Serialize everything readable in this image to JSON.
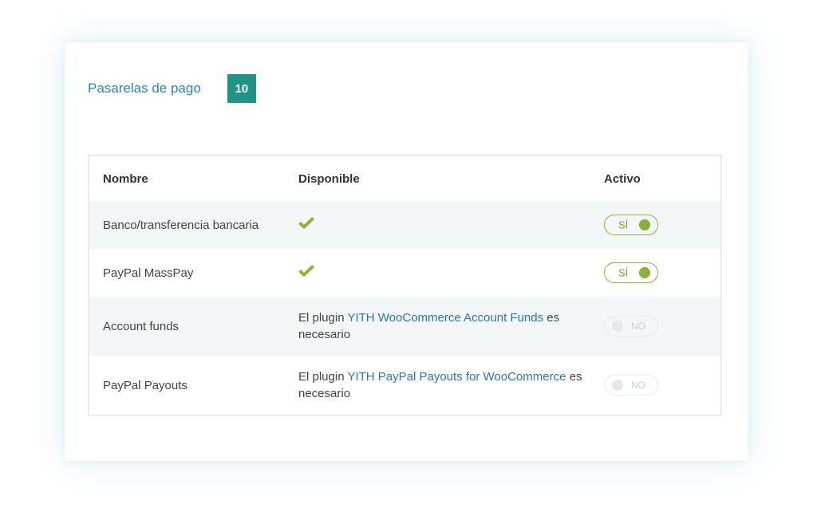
{
  "header": {
    "title": "Pasarelas de pago",
    "count": "10"
  },
  "table": {
    "columns": [
      "Nombre",
      "Disponible",
      "Activo"
    ],
    "rows": [
      {
        "name": "Banco/transferencia bancaria",
        "available": "check-icon",
        "active_label": "SÍ",
        "active": true
      },
      {
        "name": "PayPal MassPay",
        "available": "check-icon",
        "active_label": "SÍ",
        "active": true
      },
      {
        "name": "Account funds",
        "available_prefix": "El plugin",
        "available_link": "YITH WooCommerce Account Funds",
        "available_suffix": "es necesario",
        "active_label": "NO",
        "active": false
      },
      {
        "name": "PayPal Payouts",
        "available_prefix": "El plugin",
        "available_link": "YITH PayPal Payouts for WooCommerce",
        "available_suffix": "es necesario",
        "active_label": "NO",
        "active": false
      }
    ]
  },
  "colors": {
    "title": "#2d87a9",
    "badge": "#1e9387",
    "check": "#8ab53c",
    "link": "#2a74b6",
    "toggle_on": "#88b03a",
    "toggle_off": "#e6e9ea"
  }
}
